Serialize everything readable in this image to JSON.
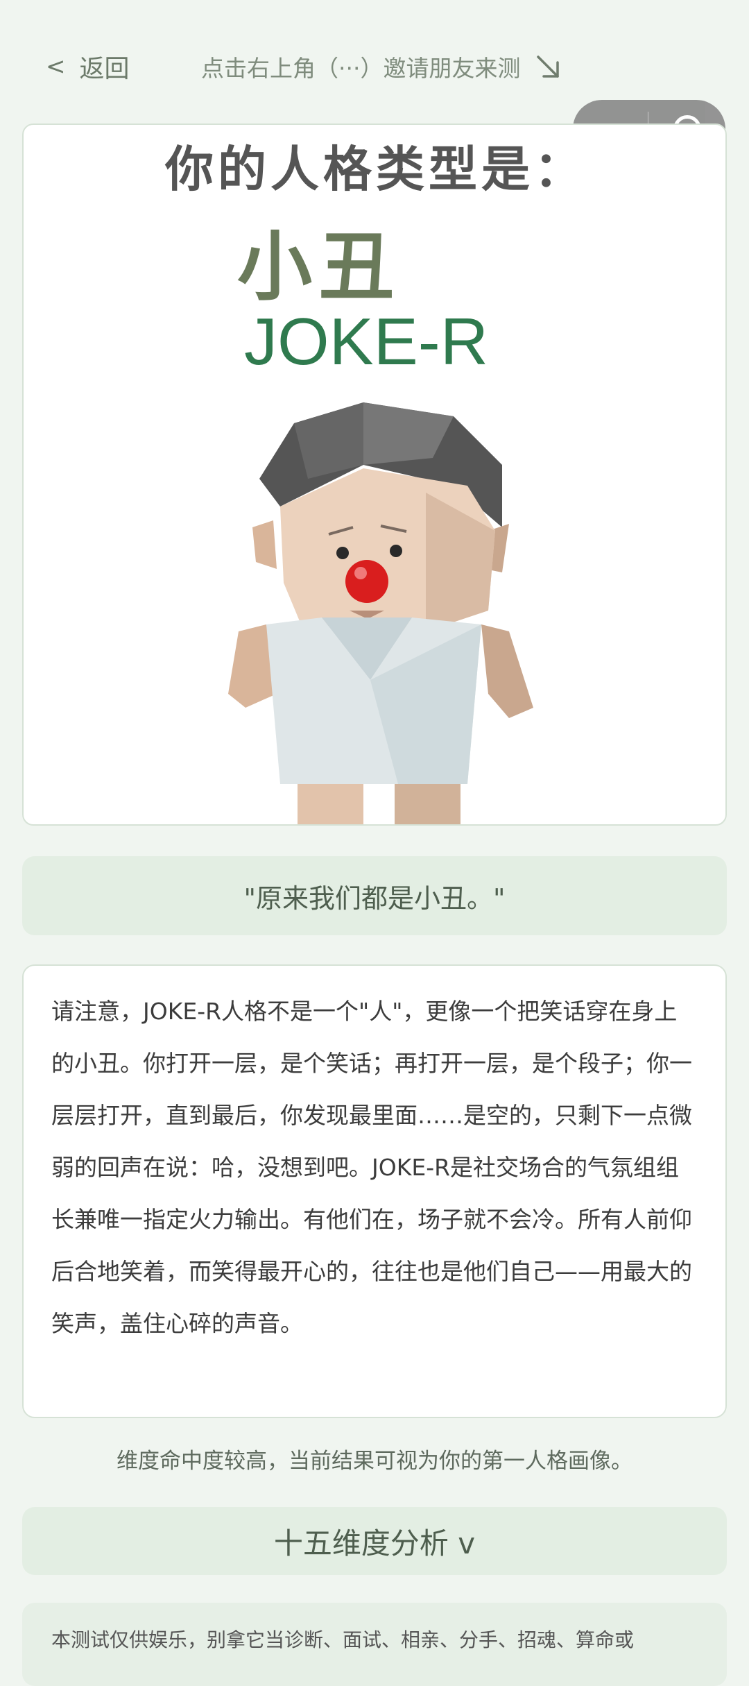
{
  "nav": {
    "back_icon": "chevron-left-icon",
    "back_label": "返回",
    "invite_text": "点击右上角（···）邀请朋友来测",
    "invite_icon": "arrow-down-right-icon"
  },
  "capsule": {
    "more_icon": "more-dots-icon",
    "close_icon": "target-close-icon"
  },
  "result": {
    "heading": "你的人格类型是：",
    "type_name": "小丑",
    "type_code": "JOKE-R"
  },
  "quote": "\"原来我们都是小丑。\"",
  "description": "请注意，JOKE-R人格不是一个\"人\"，更像一个把笑话穿在身上的小丑。你打开一层，是个笑话；再打开一层，是个段子；你一层层打开，直到最后，你发现最里面……是空的，只剩下一点微弱的回声在说：哈，没想到吧。JOKE-R是社交场合的气氛组组长兼唯一指定火力输出。有他们在，场子就不会冷。所有人前仰后合地笑着，而笑得最开心的，往往也是他们自己——用最大的笑声，盖住心碎的声音。",
  "hint": "维度命中度较高，当前结果可视为你的第一人格画像。",
  "analysis": {
    "label": "十五维度分析 v"
  },
  "disclaimer": "本测试仅供娱乐，别拿它当诊断、面试、相亲、分手、招魂、算命或"
}
